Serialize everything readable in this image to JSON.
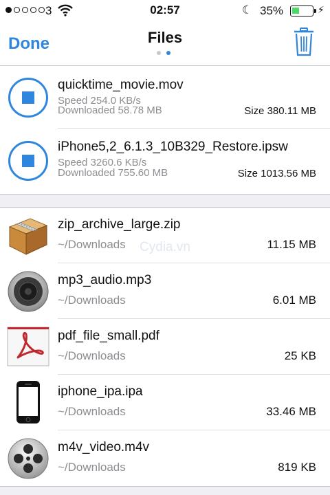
{
  "status": {
    "carrier": "3",
    "time": "02:57",
    "battery": "35%",
    "battery_level": 0.35,
    "signal_bars": 1
  },
  "nav": {
    "done": "Done",
    "title": "Files",
    "page_count": 2,
    "active_page": 2
  },
  "downloads": [
    {
      "name": "quicktime_movie.mov",
      "speed": "Speed 254.0 KB/s",
      "downloaded": "Downloaded  58.78 MB",
      "size": "Size 380.11 MB"
    },
    {
      "name": "iPhone5,2_6.1.3_10B329_Restore.ipsw",
      "speed": "Speed 3260.6 KB/s",
      "downloaded": "Downloaded  755.60 MB",
      "size": "Size 1013.56 MB"
    }
  ],
  "files": [
    {
      "name": "zip_archive_large.zip",
      "folder": "~/Downloads",
      "size": "11.15 MB",
      "icon": "zip-box-icon"
    },
    {
      "name": "mp3_audio.mp3",
      "folder": "~/Downloads",
      "size": "6.01 MB",
      "icon": "speaker-icon"
    },
    {
      "name": "pdf_file_small.pdf",
      "folder": "~/Downloads",
      "size": "25 KB",
      "icon": "pdf-icon"
    },
    {
      "name": "iphone_ipa.ipa",
      "folder": "~/Downloads",
      "size": "33.46 MB",
      "icon": "iphone-icon"
    },
    {
      "name": "m4v_video.m4v",
      "folder": "~/Downloads",
      "size": "819 KB",
      "icon": "film-reel-icon"
    }
  ],
  "watermark": "Cydia.vn",
  "colors": {
    "accent": "#2f86de",
    "battery": "#4cd964",
    "separator": "#c8c7cc",
    "gap": "#efeff4"
  }
}
